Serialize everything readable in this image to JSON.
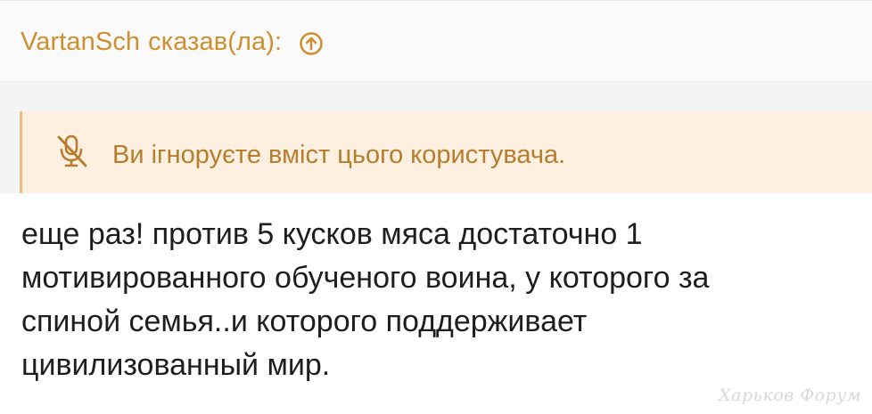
{
  "quote": {
    "author": "VartanSch",
    "said_label": "сказав(ла):",
    "jump_icon": "arrow-up-circle-icon",
    "accent_color": "#d08f2f"
  },
  "ignored_notice": {
    "icon": "microphone-muted-icon",
    "text": "Ви ігноруєте вміст цього користувача.",
    "background_color": "#fdf0e0",
    "text_color": "#b77d2d"
  },
  "post": {
    "lines": [
      "еще раз! против 5 кусков мяса достаточно 1",
      "мотивированного обученого воина, у которого за",
      "спиной семья..и которого поддерживает",
      "цивилизованный мир."
    ]
  },
  "watermark": {
    "text": "Харьков Форум"
  }
}
